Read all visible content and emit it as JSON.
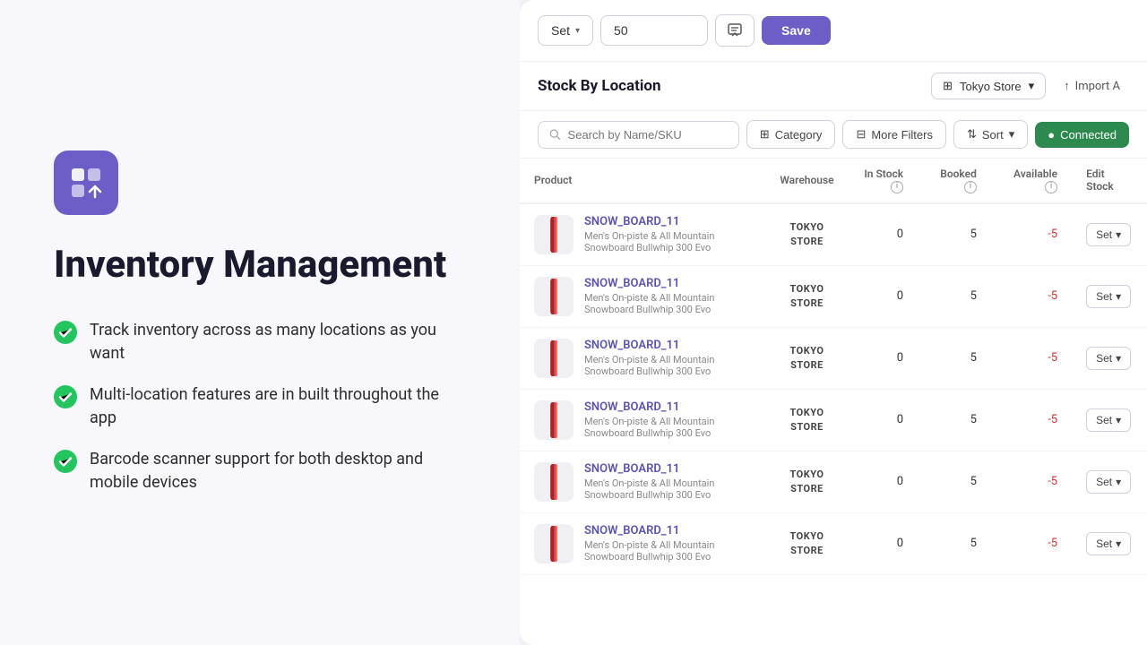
{
  "app": {
    "title": "Inventory Management"
  },
  "left": {
    "features": [
      "Track inventory across as many locations as you want",
      "Multi-location features are in built throughout the app",
      "Barcode scanner support for both desktop and mobile devices"
    ]
  },
  "toolbar": {
    "set_label": "Set",
    "qty_value": "50",
    "qty_placeholder": "50",
    "save_label": "Save"
  },
  "stock_section": {
    "title": "Stock By Location",
    "location": "Tokyo Store",
    "import_label": "Import A"
  },
  "filters": {
    "search_placeholder": "Search by Name/SKU",
    "category_label": "Category",
    "more_filters_label": "More Filters",
    "sort_label": "Sort",
    "connected_label": "Connected"
  },
  "table": {
    "columns": [
      "Product",
      "Warehouse",
      "In Stock",
      "Booked",
      "Available",
      "Edit Stock"
    ],
    "rows": [
      {
        "sku": "SNOW_BOARD_11",
        "name": "Men's On-piste & All Mountain Snowboard Bullwhip 300 Evo",
        "warehouse": "TOKYO\nSTORE",
        "in_stock": "0",
        "booked": "5",
        "available": "-5"
      },
      {
        "sku": "SNOW_BOARD_11",
        "name": "Men's On-piste & All Mountain Snowboard Bullwhip 300 Evo",
        "warehouse": "TOKYO\nSTORE",
        "in_stock": "0",
        "booked": "5",
        "available": "-5"
      },
      {
        "sku": "SNOW_BOARD_11",
        "name": "Men's On-piste & All Mountain Snowboard Bullwhip 300 Evo",
        "warehouse": "TOKYO\nSTORE",
        "in_stock": "0",
        "booked": "5",
        "available": "-5"
      },
      {
        "sku": "SNOW_BOARD_11",
        "name": "Men's On-piste & All Mountain Snowboard Bullwhip 300 Evo",
        "warehouse": "TOKYO\nSTORE",
        "in_stock": "0",
        "booked": "5",
        "available": "-5"
      },
      {
        "sku": "SNOW_BOARD_11",
        "name": "Men's On-piste & All Mountain Snowboard Bullwhip 300 Evo",
        "warehouse": "TOKYO\nSTORE",
        "in_stock": "0",
        "booked": "5",
        "available": "-5"
      },
      {
        "sku": "SNOW_BOARD_11",
        "name": "Men's On-piste & All Mountain Snowboard Bullwhip 300 Evo",
        "warehouse": "TOKYO\nSTORE",
        "in_stock": "0",
        "booked": "5",
        "available": "-5"
      }
    ]
  },
  "colors": {
    "accent": "#6b5fc7",
    "green": "#2d8a4e",
    "negative": "#cc3333",
    "link": "#5b52b8"
  }
}
